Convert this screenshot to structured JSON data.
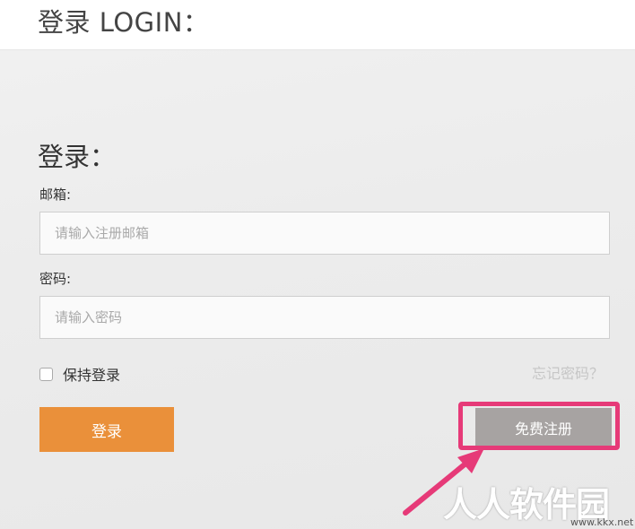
{
  "header": {
    "title": "登录 LOGIN："
  },
  "form": {
    "title": "登录：",
    "email_label": "邮箱:",
    "email_placeholder": "请输入注册邮箱",
    "email_value": "",
    "password_label": "密码:",
    "password_placeholder": "请输入密码",
    "password_value": "",
    "remember_label": "保持登录",
    "remember_checked": false,
    "forgot_link": "忘记密码？",
    "login_button": "登录",
    "register_button": "免费注册"
  },
  "annotation": {
    "highlight_color": "#e63a78"
  },
  "watermark": {
    "text": "人人软件园",
    "url": "www.kkx.net"
  },
  "colors": {
    "login_button": "#ea903a",
    "register_button": "#a7a3a2",
    "forgot_link": "#c6c6c6"
  }
}
